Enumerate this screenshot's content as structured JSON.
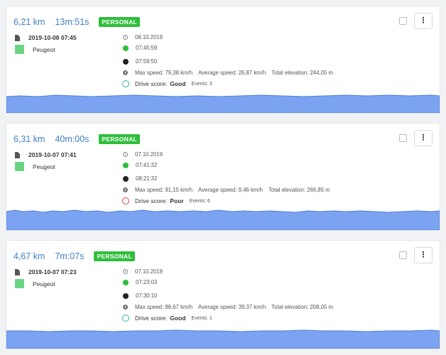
{
  "trips": [
    {
      "distance": "6,21 km",
      "duration": "13m:51s",
      "badge": "PERSONAL",
      "datetime": "2019-10-08 07:45",
      "vehicle": "Peugeot",
      "vehicle_color": "#6bd483",
      "date": "08.10.2019",
      "start_time": "07:45:59",
      "end_time": "07:59:50",
      "max_speed": "Max speed: 79,38 km/h",
      "avg_speed": "Average speed: 26,87 km/h",
      "elevation": "Total elevation: 244,05 m",
      "score_label": "Drive score:",
      "score_value": "Good",
      "events": "Events: 3"
    },
    {
      "distance": "6,31 km",
      "duration": "40m:00s",
      "badge": "PERSONAL",
      "datetime": "2019-10-07 07:41",
      "vehicle": "Peugeot",
      "vehicle_color": "#6bd483",
      "date": "07.10.2019",
      "start_time": "07:41:32",
      "end_time": "08:21:32",
      "max_speed": "Max speed: 91,15 km/h",
      "avg_speed": "Average speed: 9,46 km/h",
      "elevation": "Total elevation: 266,85 m",
      "score_label": "Drive score:",
      "score_value": "Poor",
      "events": "Events: 6"
    },
    {
      "distance": "4,67 km",
      "duration": "7m:07s",
      "badge": "PERSONAL",
      "datetime": "2019-10-07 07:23",
      "vehicle": "Peugeot",
      "vehicle_color": "#6bd483",
      "date": "07.10.2019",
      "start_time": "07:23:03",
      "end_time": "07:30:10",
      "max_speed": "Max speed: 88,67 km/h",
      "avg_speed": "Average speed: 39,37 km/h",
      "elevation": "Total elevation: 208,05 m",
      "score_label": "Drive score:",
      "score_value": "Good",
      "events": "Events: 1"
    }
  ],
  "icons": {
    "document": "document-icon",
    "clock": "clock-icon",
    "start": "green-dot-icon",
    "end": "black-dot-icon",
    "info": "info-icon",
    "score": "score-ring-icon",
    "menu": "kebab-menu-icon"
  },
  "menu_glyph": "⋮",
  "colors": {
    "accent": "#3f7fc9",
    "badge": "#2fbe3c",
    "elevation_fill": "#7ba3f2",
    "score_good": "#2bb7a0",
    "score_poor": "#d9463f"
  }
}
